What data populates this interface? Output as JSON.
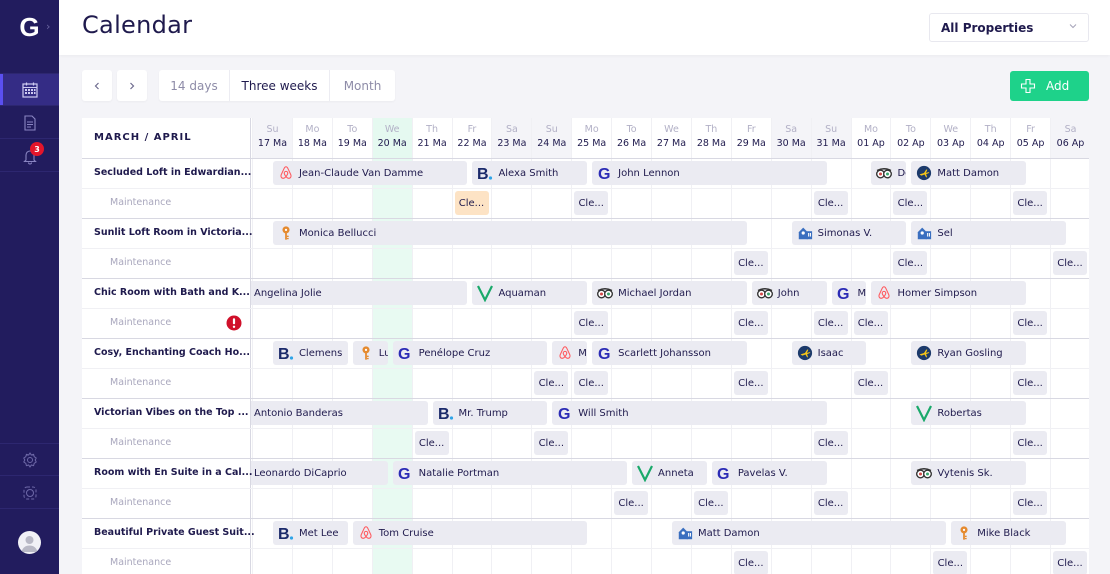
{
  "app": {
    "logo_letter": "G",
    "title": "Calendar"
  },
  "sidebar": {
    "items": [
      {
        "name": "calendar",
        "icon": "calendar-icon",
        "active": true
      },
      {
        "name": "documents",
        "icon": "document-icon",
        "active": false
      },
      {
        "name": "notifications",
        "icon": "bell-icon",
        "active": false,
        "badge": "3"
      }
    ],
    "bottom_items": [
      {
        "name": "settings",
        "icon": "gear-icon"
      },
      {
        "name": "integrations",
        "icon": "cog-outline-icon"
      }
    ]
  },
  "header": {
    "property_filter": {
      "selected": "All Properties"
    }
  },
  "toolbar": {
    "prev_icon": "chevron-left-icon",
    "next_icon": "chevron-right-icon",
    "views": [
      {
        "label": "14 days",
        "active": false
      },
      {
        "label": "Three weeks",
        "active": true
      },
      {
        "label": "Month",
        "active": false
      }
    ],
    "add_label": "Add",
    "add_color": "#1ed28a"
  },
  "calendar": {
    "period_label": "MARCH / APRIL",
    "today_index": 3,
    "maintenance_label": "Maintenance",
    "days": [
      {
        "dn": "Su",
        "dd": "17 Ma",
        "weekend": true
      },
      {
        "dn": "Mo",
        "dd": "18 Ma",
        "weekend": false
      },
      {
        "dn": "To",
        "dd": "19 Ma",
        "weekend": false
      },
      {
        "dn": "We",
        "dd": "20 Ma",
        "weekend": false
      },
      {
        "dn": "Th",
        "dd": "21 Ma",
        "weekend": false
      },
      {
        "dn": "Fr",
        "dd": "22 Ma",
        "weekend": false
      },
      {
        "dn": "Sa",
        "dd": "23 Ma",
        "weekend": true
      },
      {
        "dn": "Su",
        "dd": "24 Ma",
        "weekend": true
      },
      {
        "dn": "Mo",
        "dd": "25 Ma",
        "weekend": false
      },
      {
        "dn": "To",
        "dd": "26 Ma",
        "weekend": false
      },
      {
        "dn": "We",
        "dd": "27 Ma",
        "weekend": false
      },
      {
        "dn": "Th",
        "dd": "28 Ma",
        "weekend": false
      },
      {
        "dn": "Fr",
        "dd": "29 Ma",
        "weekend": false
      },
      {
        "dn": "Sa",
        "dd": "30 Ma",
        "weekend": true
      },
      {
        "dn": "Su",
        "dd": "31 Ma",
        "weekend": true
      },
      {
        "dn": "Mo",
        "dd": "01 Ap",
        "weekend": false
      },
      {
        "dn": "To",
        "dd": "02 Ap",
        "weekend": false
      },
      {
        "dn": "We",
        "dd": "03 Ap",
        "weekend": false
      },
      {
        "dn": "Th",
        "dd": "04 Ap",
        "weekend": false
      },
      {
        "dn": "Fr",
        "dd": "05 Ap",
        "weekend": false
      },
      {
        "dn": "Sa",
        "dd": "06 Ap",
        "weekend": true
      }
    ],
    "cleaning_label": "Cle...",
    "properties": [
      {
        "name": "Secluded Loft in Edwardian...",
        "warning": false,
        "bookings": [
          {
            "guest": "Jean-Claude Van Damme",
            "source": "airbnb",
            "start": 0.5,
            "end": 5.4
          },
          {
            "guest": "Alexa Smith",
            "source": "booking",
            "start": 5.5,
            "end": 8.4
          },
          {
            "guest": "John Lennon",
            "source": "guesty",
            "start": 8.5,
            "end": 14.4
          },
          {
            "guest": "De",
            "source": "tripadvisor",
            "start": 15.5,
            "end": 16.4
          },
          {
            "guest": "Matt Damon",
            "source": "expedia",
            "start": 16.5,
            "end": 19.4
          }
        ],
        "cleanings": [
          {
            "day": 5,
            "highlight": true
          },
          {
            "day": 8
          },
          {
            "day": 14
          },
          {
            "day": 16
          },
          {
            "day": 19
          }
        ]
      },
      {
        "name": "Sunlit Loft Room in Victoria...",
        "warning": false,
        "bookings": [
          {
            "guest": "Monica Bellucci",
            "source": "key",
            "start": 0.5,
            "end": 12.4
          },
          {
            "guest": "Simonas V.",
            "source": "homeaway",
            "start": 13.5,
            "end": 16.4
          },
          {
            "guest": "Sel",
            "source": "homeaway",
            "start": 16.5,
            "end": 20.4
          }
        ],
        "cleanings": [
          {
            "day": 12
          },
          {
            "day": 16
          },
          {
            "day": 20
          }
        ]
      },
      {
        "name": "Chic Room with Bath and K...",
        "warning": true,
        "bookings": [
          {
            "guest": "Angelina Jolie",
            "source": "none",
            "start": -1,
            "end": 5.4
          },
          {
            "guest": "Aquaman",
            "source": "vrbo",
            "start": 5.5,
            "end": 8.4
          },
          {
            "guest": "Michael Jordan",
            "source": "tripadvisor",
            "start": 8.5,
            "end": 12.4
          },
          {
            "guest": "John",
            "source": "tripadvisor",
            "start": 12.5,
            "end": 14.4
          },
          {
            "guest": "M",
            "source": "guesty",
            "start": 14.5,
            "end": 15.4
          },
          {
            "guest": "Homer Simpson",
            "source": "airbnb",
            "start": 15.5,
            "end": 19.4
          }
        ],
        "cleanings": [
          {
            "day": 8
          },
          {
            "day": 12
          },
          {
            "day": 14
          },
          {
            "day": 15
          },
          {
            "day": 19
          }
        ]
      },
      {
        "name": "Cosy, Enchanting Coach Ho...",
        "warning": false,
        "bookings": [
          {
            "guest": "Clemens",
            "source": "booking",
            "start": 0.5,
            "end": 2.4
          },
          {
            "guest": "Lu",
            "source": "key",
            "start": 2.5,
            "end": 3.4
          },
          {
            "guest": "Penélope Cruz",
            "source": "guesty",
            "start": 3.5,
            "end": 7.4
          },
          {
            "guest": "M",
            "source": "airbnb",
            "start": 7.5,
            "end": 8.4
          },
          {
            "guest": "Scarlett Johansson",
            "source": "guesty",
            "start": 8.5,
            "end": 12.4
          },
          {
            "guest": "Isaac",
            "source": "expedia",
            "start": 13.5,
            "end": 15.4
          },
          {
            "guest": "Ryan Gosling",
            "source": "expedia",
            "start": 16.5,
            "end": 19.4
          }
        ],
        "cleanings": [
          {
            "day": 7
          },
          {
            "day": 8
          },
          {
            "day": 12
          },
          {
            "day": 15
          },
          {
            "day": 19
          }
        ]
      },
      {
        "name": "Victorian Vibes on the Top ...",
        "warning": false,
        "bookings": [
          {
            "guest": "Antonio Banderas",
            "source": "none",
            "start": -1,
            "end": 4.4
          },
          {
            "guest": "Mr. Trump",
            "source": "booking",
            "start": 4.5,
            "end": 7.4
          },
          {
            "guest": "Will Smith",
            "source": "guesty",
            "start": 7.5,
            "end": 14.4
          },
          {
            "guest": "Robertas",
            "source": "vrbo",
            "start": 16.5,
            "end": 19.4
          }
        ],
        "cleanings": [
          {
            "day": 4
          },
          {
            "day": 7
          },
          {
            "day": 14
          },
          {
            "day": 19
          }
        ]
      },
      {
        "name": "Room with En Suite in a Cal...",
        "warning": false,
        "bookings": [
          {
            "guest": "Leonardo DiCaprio",
            "source": "none",
            "start": -1,
            "end": 3.4
          },
          {
            "guest": "Natalie Portman",
            "source": "guesty",
            "start": 3.5,
            "end": 9.4
          },
          {
            "guest": "Anneta",
            "source": "vrbo",
            "start": 9.5,
            "end": 11.4
          },
          {
            "guest": "Pavelas V.",
            "source": "guesty",
            "start": 11.5,
            "end": 14.4
          },
          {
            "guest": "Vytenis Sk.",
            "source": "tripadvisor",
            "start": 16.5,
            "end": 19.4
          }
        ],
        "cleanings": [
          {
            "day": 9
          },
          {
            "day": 11
          },
          {
            "day": 14
          },
          {
            "day": 19
          }
        ]
      },
      {
        "name": "Beautiful Private Guest Suit...",
        "warning": false,
        "bookings": [
          {
            "guest": "Met Lee",
            "source": "booking",
            "start": 0.5,
            "end": 2.4
          },
          {
            "guest": "Tom Cruise",
            "source": "airbnb",
            "start": 2.5,
            "end": 8.4
          },
          {
            "guest": "Matt Damon",
            "source": "homeaway",
            "start": 10.5,
            "end": 17.4
          },
          {
            "guest": "Mike Black",
            "source": "key",
            "start": 17.5,
            "end": 20.4
          }
        ],
        "cleanings": [
          {
            "day": 12
          },
          {
            "day": 17
          },
          {
            "day": 20
          }
        ]
      }
    ]
  },
  "colors": {
    "sidebar": "#221c5e",
    "accent_green": "#1ed28a",
    "today_column": "#e8faf2",
    "booking_bg": "#ebebf2",
    "cleaning_highlight": "#fde3c5",
    "badge_red": "#e3152b",
    "guesty_blue": "#2b2bb5",
    "airbnb_red": "#ff5a5f",
    "vrbo_green": "#1aa96a",
    "expedia_navy": "#1c3a6b",
    "key_orange": "#e58a2e",
    "homeaway_blue": "#3a6fc0"
  }
}
